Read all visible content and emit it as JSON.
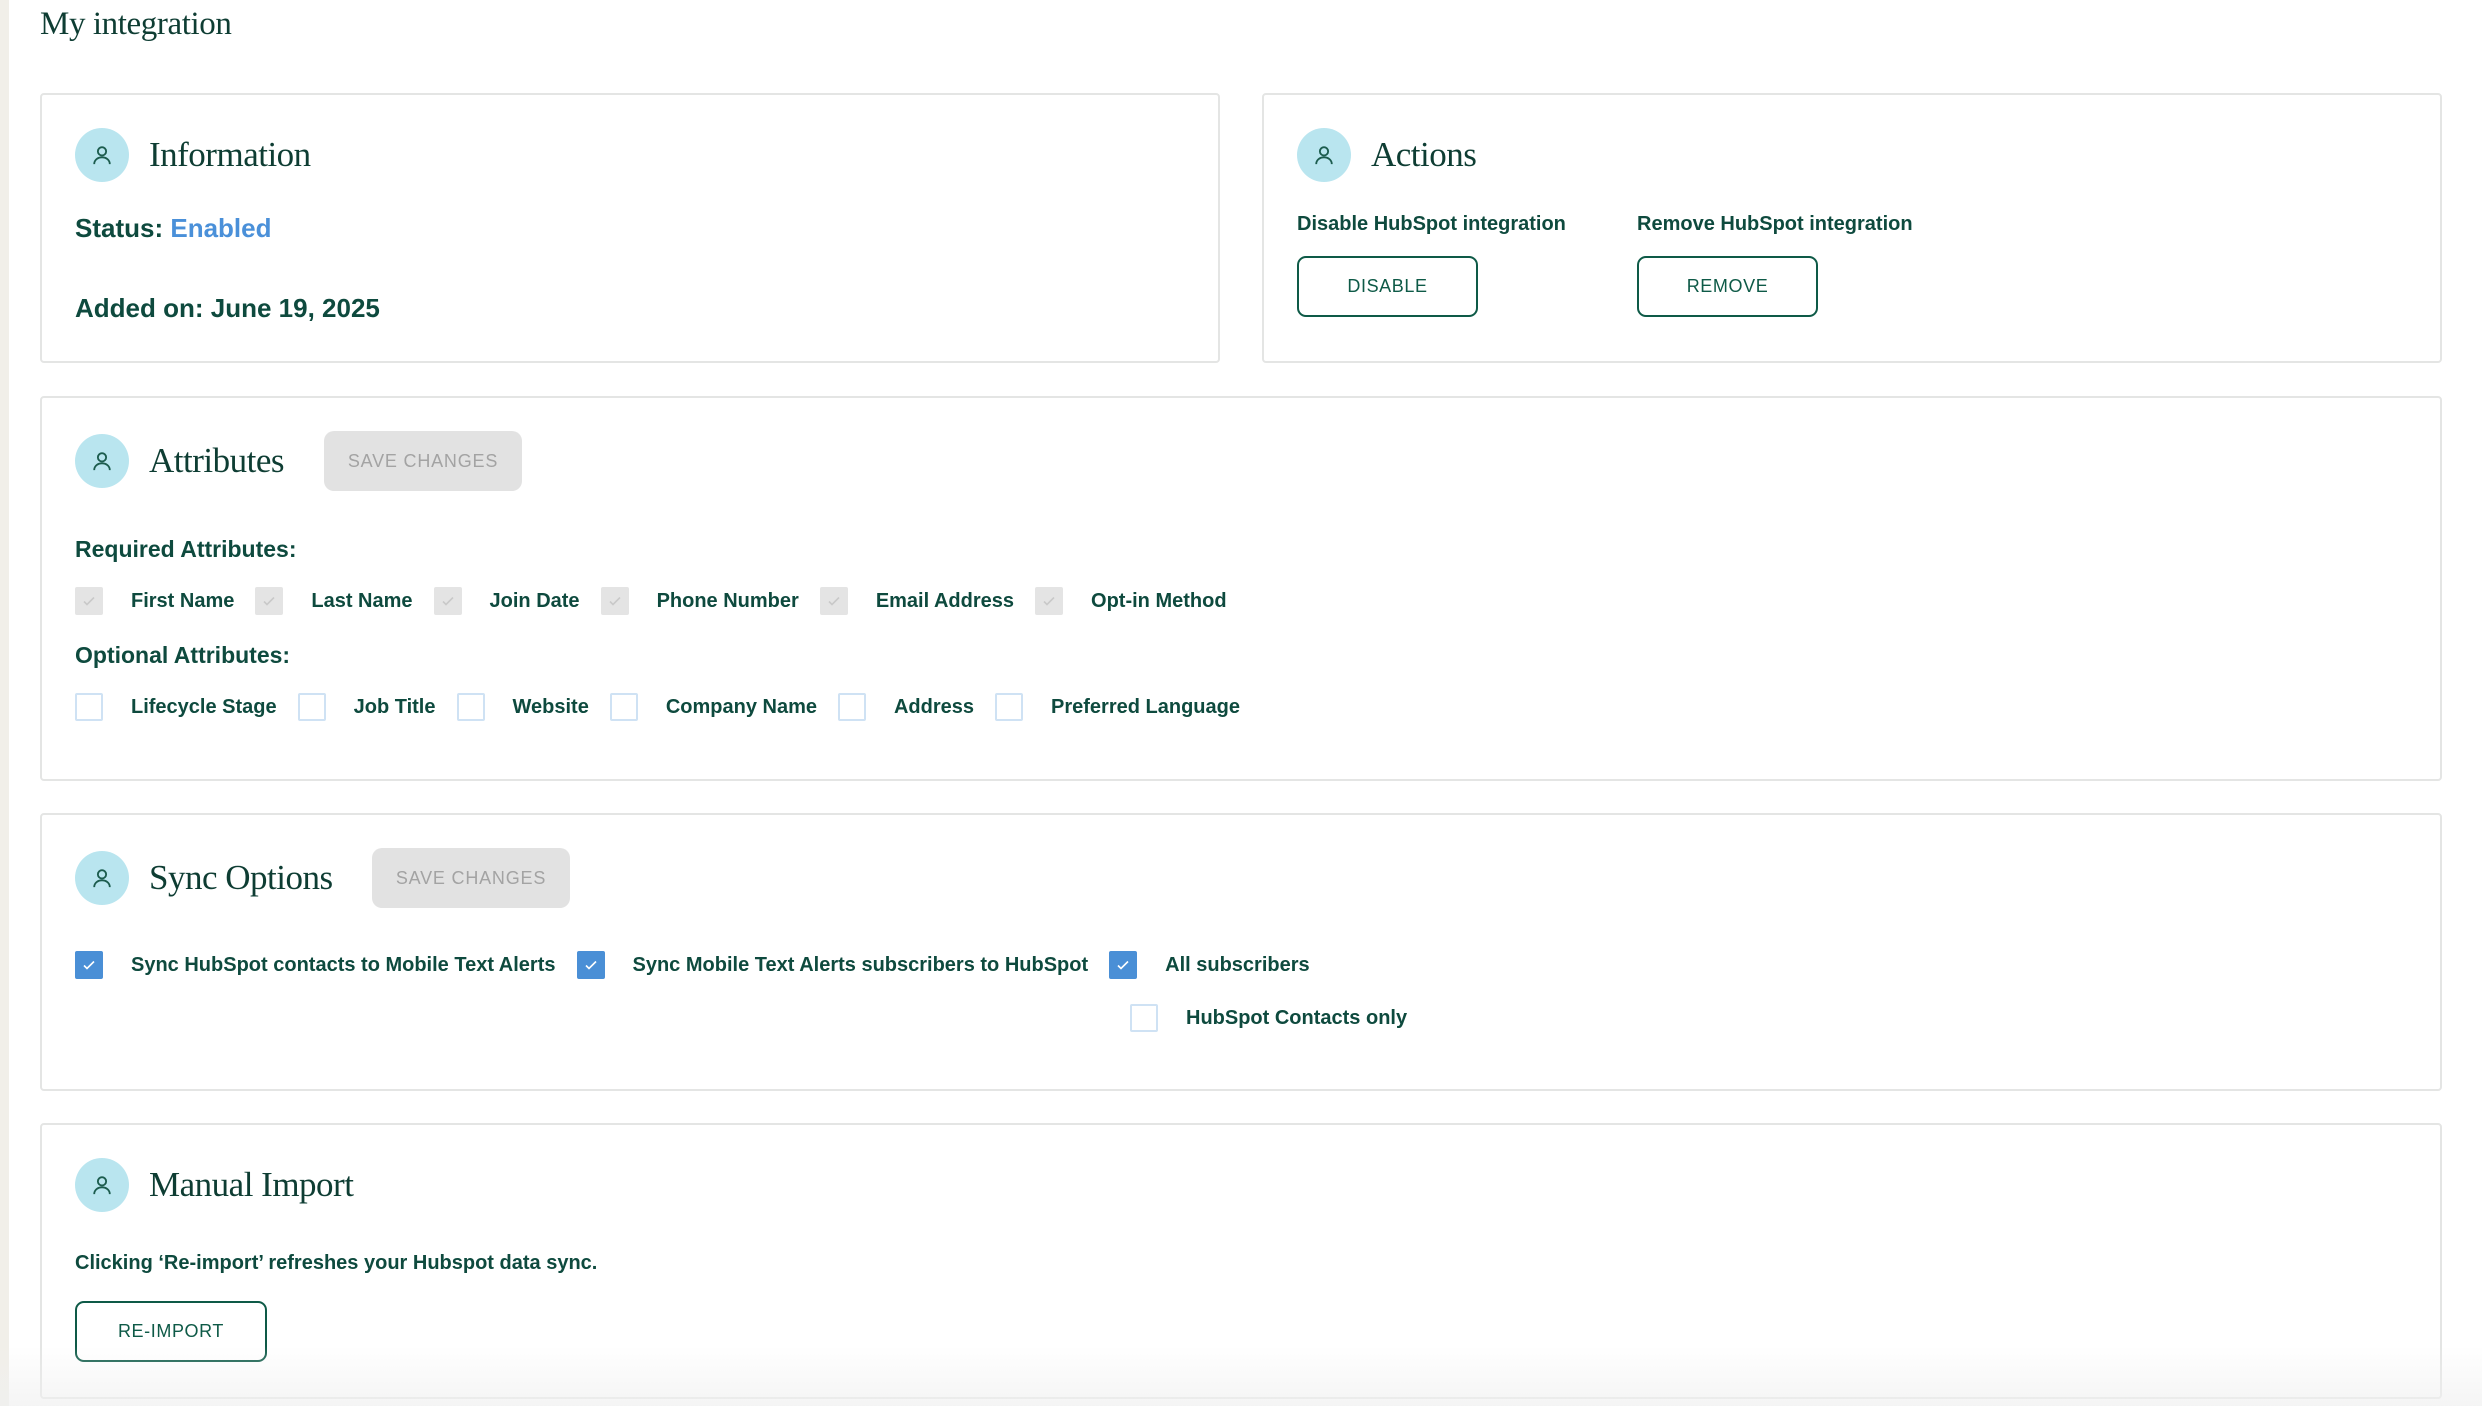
{
  "page": {
    "title": "My integration"
  },
  "information": {
    "title": "Information",
    "status_label": "Status:",
    "status_value": "Enabled",
    "added_label": "Added on: June 19, 2025"
  },
  "actions": {
    "title": "Actions",
    "disable_label": "Disable HubSpot integration",
    "disable_button": "DISABLE",
    "remove_label": "Remove HubSpot integration",
    "remove_button": "REMOVE"
  },
  "attributes": {
    "title": "Attributes",
    "save_button": "SAVE CHANGES",
    "required_label": "Required Attributes:",
    "required": [
      "First Name",
      "Last Name",
      "Join Date",
      "Phone Number",
      "Email Address",
      "Opt-in Method"
    ],
    "optional_label": "Optional Attributes:",
    "optional": [
      "Lifecycle Stage",
      "Job Title",
      "Website",
      "Company Name",
      "Address",
      "Preferred Language"
    ]
  },
  "sync": {
    "title": "Sync Options",
    "save_button": "SAVE CHANGES",
    "options": [
      {
        "label": "Sync HubSpot contacts to Mobile Text Alerts",
        "checked": true
      },
      {
        "label": "Sync Mobile Text Alerts subscribers to HubSpot",
        "checked": true
      },
      {
        "label": "All subscribers",
        "checked": true
      },
      {
        "label": "HubSpot Contacts only",
        "checked": false
      }
    ]
  },
  "manual_import": {
    "title": "Manual Import",
    "description": "Clicking ‘Re-import’ refreshes your Hubspot data sync.",
    "button": "RE-IMPORT"
  },
  "colors": {
    "accent_green": "#0e5a47",
    "status_blue": "#4a90d9",
    "avatar_bg": "#b9e5ef",
    "checkbox_checked": "#4a8fd6"
  },
  "icons": {
    "section_avatar": "user-icon",
    "checkmark": "checkmark-icon"
  }
}
